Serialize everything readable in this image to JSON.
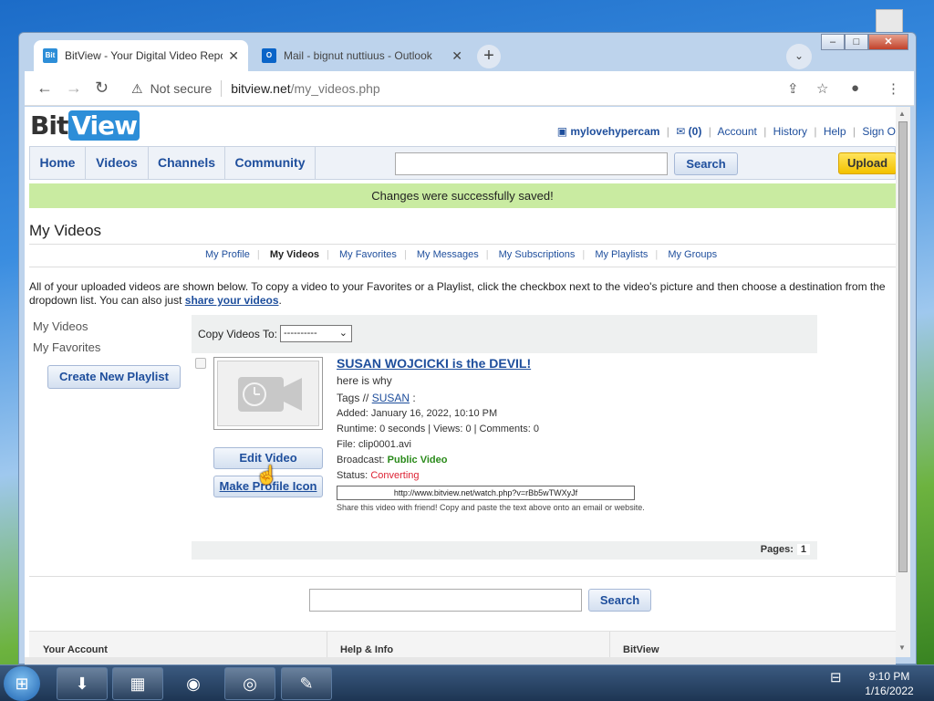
{
  "browser": {
    "tabs": [
      {
        "title": "BitView - Your Digital Video Repo",
        "favicon": "Bit"
      },
      {
        "title": "Mail - bignut nuttiuus - Outlook",
        "favicon": "O"
      }
    ],
    "new_tab": "+",
    "url_status": "Not secure",
    "url_host": "bitview.net",
    "url_path": "/my_videos.php"
  },
  "site": {
    "logo_a": "Bit",
    "logo_b": "View",
    "user": "mylovehypercam",
    "messages": "(0)",
    "account": "Account",
    "history": "History",
    "help": "Help",
    "signout": "Sign O",
    "nav": [
      "Home",
      "Videos",
      "Channels",
      "Community"
    ],
    "search_btn": "Search",
    "upload": "Upload",
    "success": "Changes were successfully saved!",
    "page_title": "My Videos",
    "subnav": [
      "My Profile",
      "My Videos",
      "My Favorites",
      "My Messages",
      "My Subscriptions",
      "My Playlists",
      "My Groups"
    ],
    "intro": "All of your uploaded videos are shown below. To copy a video to your Favorites or a Playlist, click the checkbox next to the video's picture and then choose a destination from the dropdown list. You can also just ",
    "intro_link": "share your videos",
    "intro_end": ".",
    "side": [
      "My Videos",
      "My Favorites"
    ],
    "create_playlist": "Create New Playlist",
    "copy_label": "Copy Videos To:",
    "copy_select": "----------",
    "video": {
      "title": "SUSAN WOJCICKI is the DEVIL!",
      "desc": "here is why",
      "tags_label": "Tags //",
      "tag": "SUSAN",
      "tag_end": ":",
      "added": "Added: January 16, 2022, 10:10 PM",
      "runtime": "Runtime: 0 seconds | Views: 0 | Comments: 0",
      "file": "File: clip0001.avi",
      "broadcast_label": "Broadcast:",
      "broadcast": "Public Video",
      "status_label": "Status:",
      "status": "Converting",
      "url": "http://www.bitview.net/watch.php?v=rBb5wTWXyJf",
      "share": "Share this video with friend! Copy and paste the text above onto an email or website.",
      "edit": "Edit Video",
      "profile_icon": "Make Profile Icon"
    },
    "pages_label": "Pages:",
    "page_num": "1",
    "footer": [
      "Your Account",
      "Help & Info",
      "BitView"
    ]
  },
  "taskbar": {
    "time": "9:10 PM",
    "date": "1/16/2022"
  }
}
